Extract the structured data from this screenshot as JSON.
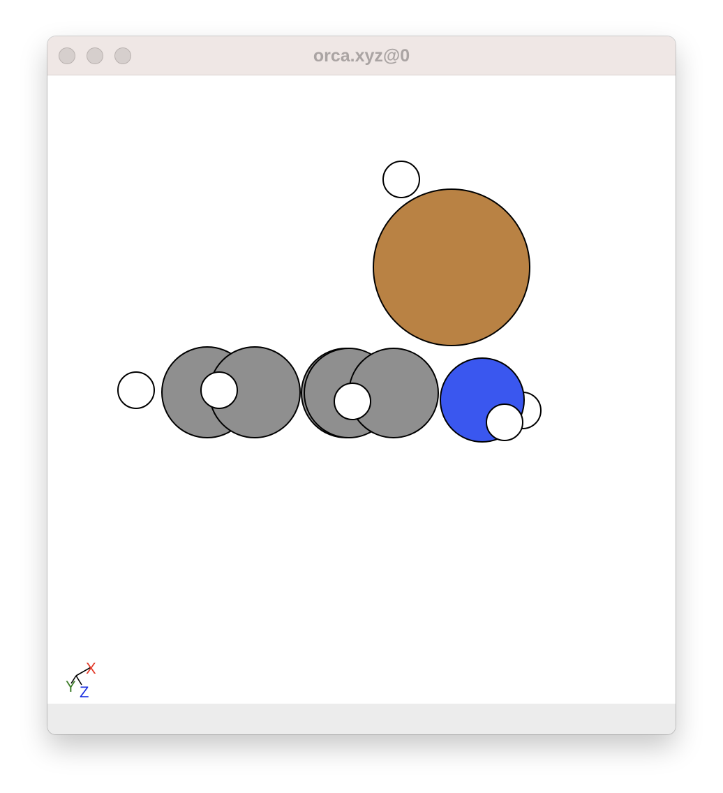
{
  "window": {
    "title": "orca.xyz@0"
  },
  "window_controls": [
    {
      "name": "close-button",
      "label": "close"
    },
    {
      "name": "minimize-button",
      "label": "minimize"
    },
    {
      "name": "zoom-button",
      "label": "zoom"
    }
  ],
  "molecule": {
    "atoms": [
      {
        "name": "atom-carbon-1",
        "element": "C",
        "color": "#8f8f8f"
      },
      {
        "name": "atom-carbon-2",
        "element": "C",
        "color": "#8f8f8f"
      },
      {
        "name": "atom-carbon-3",
        "element": "C",
        "color": "#8f8f8f"
      },
      {
        "name": "atom-carbon-4",
        "element": "C",
        "color": "#8f8f8f"
      },
      {
        "name": "atom-carbon-5",
        "element": "C",
        "color": "#8f8f8f"
      },
      {
        "name": "atom-nitrogen-1",
        "element": "N",
        "color": "#3a57ef"
      },
      {
        "name": "atom-copper-1",
        "element": "Cu",
        "color": "#b98244"
      },
      {
        "name": "atom-hydrogen-1",
        "element": "H",
        "color": "#ffffff"
      },
      {
        "name": "atom-hydrogen-2",
        "element": "H",
        "color": "#ffffff"
      },
      {
        "name": "atom-hydrogen-3",
        "element": "H",
        "color": "#ffffff"
      },
      {
        "name": "atom-hydrogen-4",
        "element": "H",
        "color": "#ffffff"
      },
      {
        "name": "atom-hydrogen-5",
        "element": "H",
        "color": "#ffffff"
      },
      {
        "name": "atom-hydrogen-6",
        "element": "H",
        "color": "#ffffff"
      }
    ]
  },
  "axes_triad": {
    "x_label": "X",
    "y_label": "Y",
    "z_label": "Z",
    "x_color": "#e23b2a",
    "y_color": "#3f7d2a",
    "z_color": "#1b2fe0"
  }
}
